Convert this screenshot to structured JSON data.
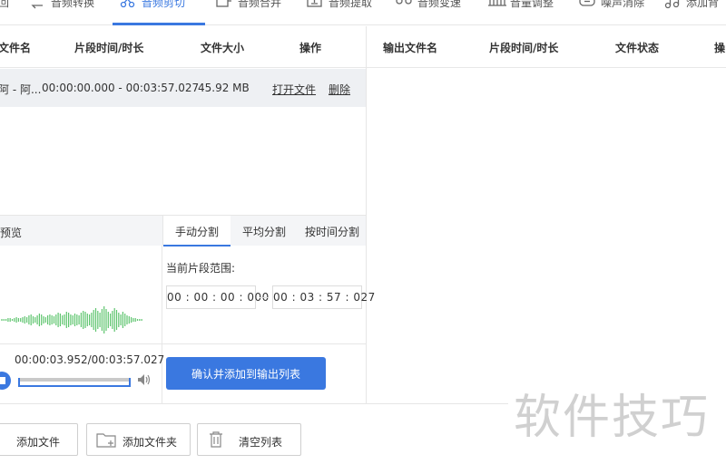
{
  "toolbar": {
    "items": [
      {
        "label": "回",
        "icon": "home-icon"
      },
      {
        "label": "音频转换",
        "icon": "convert-icon"
      },
      {
        "label": "音频剪切",
        "icon": "scissors-icon"
      },
      {
        "label": "音频合并",
        "icon": "merge-icon"
      },
      {
        "label": "音频提取",
        "icon": "extract-icon"
      },
      {
        "label": "音频变速",
        "icon": "speed-icon"
      },
      {
        "label": "音量调整",
        "icon": "volume-adjust-icon"
      },
      {
        "label": "噪声消除",
        "icon": "noise-icon"
      },
      {
        "label": "添加背",
        "icon": "music-note-icon"
      }
    ],
    "active_index": 2,
    "accent": "#3a78e0"
  },
  "left_table": {
    "headers": [
      "文件名",
      "片段时间/时长",
      "文件大小",
      "操作"
    ],
    "row": {
      "filename": "阿 - 阿...",
      "range": "00:00:00.000 - 00:03:57.027",
      "size": "45.92 MB",
      "open_label": "打开文件",
      "delete_label": "删除"
    }
  },
  "right_table": {
    "headers": [
      "输出文件名",
      "片段时间/时长",
      "文件状态",
      "操"
    ]
  },
  "preview": {
    "label": "预览",
    "play_time": "00:00:03.952/00:03:57.027",
    "progress": 0.017
  },
  "split": {
    "tabs": [
      "手动分割",
      "平均分割",
      "按时间分割"
    ],
    "active_tab": 0,
    "range_label": "当前片段范围:",
    "start_time": "00 : 00 : 00 : 000",
    "end_time": "00 : 03 : 57 : 027",
    "confirm_label": "确认并添加到输出列表"
  },
  "bottom": {
    "add_file": "添加文件",
    "add_folder": "添加文件夹",
    "clear_list": "清空列表"
  },
  "watermark": "软件技巧"
}
